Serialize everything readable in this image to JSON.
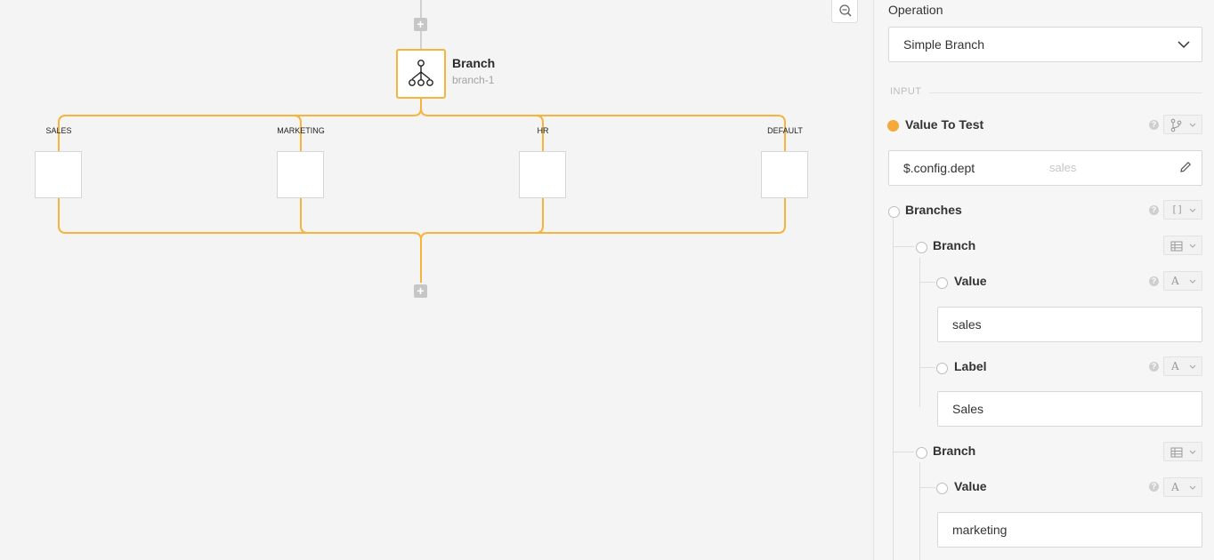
{
  "canvas": {
    "node": {
      "title": "Branch",
      "subtitle": "branch-1"
    },
    "branches": [
      "SALES",
      "MARKETING",
      "HR",
      "DEFAULT"
    ]
  },
  "panel": {
    "operation_label": "Operation",
    "operation_value": "Simple Branch",
    "section_input": "INPUT",
    "value_to_test": {
      "label": "Value To Test",
      "value": "$.config.dept",
      "preview": "sales"
    },
    "branches_label": "Branches",
    "branch_items": [
      {
        "label": "Branch",
        "value_label": "Value",
        "value": "sales",
        "label_label": "Label",
        "label_value": "Sales"
      },
      {
        "label": "Branch",
        "value_label": "Value",
        "value": "marketing"
      }
    ]
  },
  "colors": {
    "accent": "#f5b43c",
    "dot_orange": "#f5a93a",
    "canvas_bg": "#f4f4f4"
  },
  "icons": [
    "plus-icon",
    "zoom-out-icon",
    "branch-tree-icon",
    "chevron-down-icon",
    "help-icon",
    "git-branch-icon",
    "pencil-icon",
    "array-icon",
    "table-icon",
    "text-type-icon"
  ]
}
